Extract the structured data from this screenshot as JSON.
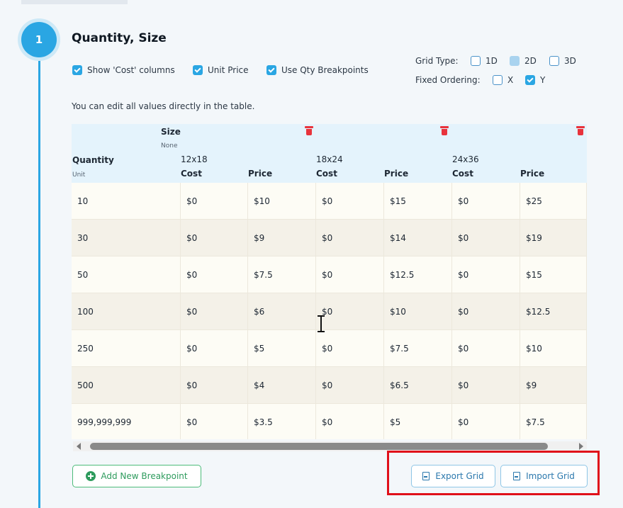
{
  "step": {
    "number": "1",
    "title": "Quantity, Size"
  },
  "options": {
    "show_cost": {
      "label": "Show 'Cost' columns",
      "checked": true
    },
    "unit_price": {
      "label": "Unit Price",
      "checked": true
    },
    "use_qty_breakpoints": {
      "label": "Use Qty Breakpoints",
      "checked": true
    }
  },
  "grid_type": {
    "label": "Grid Type:",
    "options": [
      {
        "label": "1D",
        "checked": false
      },
      {
        "label": "2D",
        "checked": true
      },
      {
        "label": "3D",
        "checked": false
      }
    ]
  },
  "fixed_ordering": {
    "label": "Fixed Ordering:",
    "options": [
      {
        "label": "X",
        "checked": false
      },
      {
        "label": "Y",
        "checked": true
      }
    ]
  },
  "hint": "You can edit all values directly in the table.",
  "table": {
    "size_label": "Size",
    "size_sub": "None",
    "quantity_label": "Quantity",
    "unit_label": "Unit",
    "sizes": [
      "12x18",
      "18x24",
      "24x36"
    ],
    "cost_label": "Cost",
    "price_label": "Price",
    "rows": [
      {
        "qty": "10",
        "cells": [
          "$0",
          "$10",
          "$0",
          "$15",
          "$0",
          "$25"
        ]
      },
      {
        "qty": "30",
        "cells": [
          "$0",
          "$9",
          "$0",
          "$14",
          "$0",
          "$19"
        ]
      },
      {
        "qty": "50",
        "cells": [
          "$0",
          "$7.5",
          "$0",
          "$12.5",
          "$0",
          "$15"
        ]
      },
      {
        "qty": "100",
        "cells": [
          "$0",
          "$6",
          "$0",
          "$10",
          "$0",
          "$12.5"
        ]
      },
      {
        "qty": "250",
        "cells": [
          "$0",
          "$5",
          "$0",
          "$7.5",
          "$0",
          "$10"
        ]
      },
      {
        "qty": "500",
        "cells": [
          "$0",
          "$4",
          "$0",
          "$6.5",
          "$0",
          "$9"
        ]
      },
      {
        "qty": "999,999,999",
        "cells": [
          "$0",
          "$3.5",
          "$0",
          "$5",
          "$0",
          "$7.5"
        ]
      }
    ]
  },
  "buttons": {
    "add_breakpoint": "Add New Breakpoint",
    "export_grid": "Export Grid",
    "import_grid": "Import Grid"
  },
  "colors": {
    "accent": "#2aa6e3",
    "delete": "#e8333c",
    "add": "#2e9b5d",
    "highlight": "#e0101a"
  }
}
